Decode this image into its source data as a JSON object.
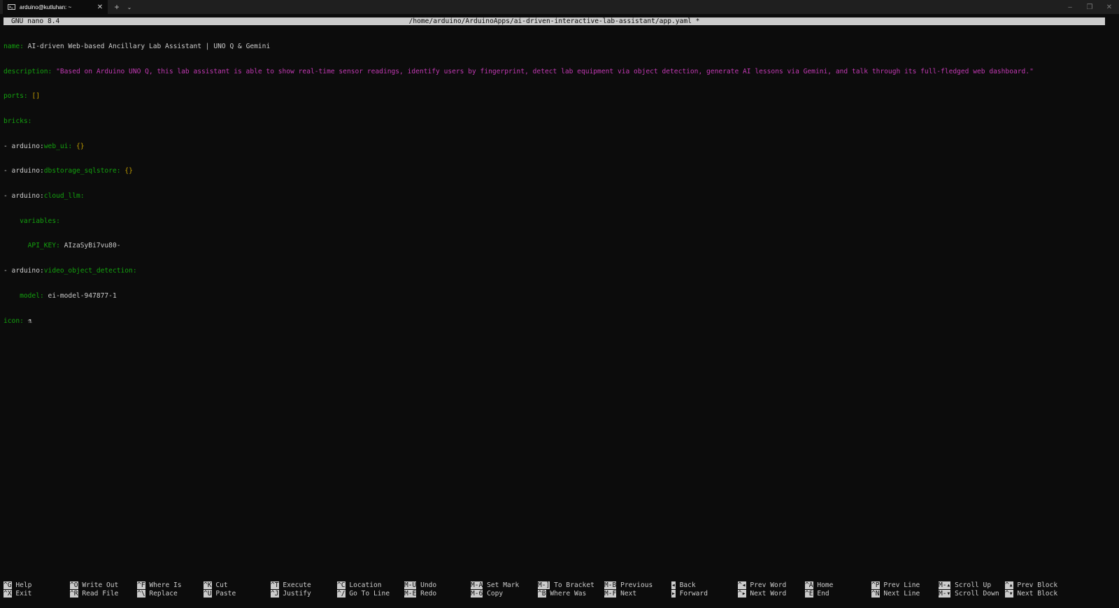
{
  "titlebar": {
    "tab_title": "arduino@kutluhan: ~",
    "tab_icon": "terminal-icon",
    "close_icon": "close-icon",
    "new_tab_symbol": "+",
    "dropdown_symbol": "⌄",
    "minimize_symbol": "–",
    "restore_symbol": "❐",
    "close_window_symbol": "✕"
  },
  "nano": {
    "version": "GNU nano 8.4",
    "path": "/home/arduino/ArduinoApps/ai-driven-interactive-lab-assistant/app.yaml *"
  },
  "editor": {
    "name_key": "name:",
    "name_value": " AI-driven Web-based Ancillary Lab Assistant | UNO Q & Gemini",
    "description_key": "description:",
    "description_value": " \"Based on Arduino UNO Q, this lab assistant is able to show real-time sensor readings, identify users by fingerprint, detect lab equipment via object detection, generate AI lessons via Gemini, and talk through its full-fledged web dashboard.\"",
    "ports_key": "ports:",
    "ports_value": "[]",
    "bricks_key": "bricks:",
    "brick1_prefix": "- arduino:",
    "brick1_name": "web_ui:",
    "brick1_value": "{}",
    "brick2_prefix": "- arduino:",
    "brick2_name": "dbstorage_sqlstore:",
    "brick2_value": "{}",
    "brick3_prefix": "- arduino:",
    "brick3_name": "cloud_llm:",
    "variables_key": "variables:",
    "api_key_key": "API_KEY:",
    "api_key_value": " AIzaSyBi7vu80-",
    "brick4_prefix": "- arduino:",
    "brick4_name": "video_object_detection:",
    "model_key": "model:",
    "model_value": " ei-model-947877-1",
    "icon_key": "icon:",
    "icon_value": " ⚗"
  },
  "shortcuts": {
    "row1": [
      {
        "key": "^G",
        "label": "Help"
      },
      {
        "key": "^O",
        "label": "Write Out"
      },
      {
        "key": "^F",
        "label": "Where Is"
      },
      {
        "key": "^K",
        "label": "Cut"
      },
      {
        "key": "^T",
        "label": "Execute"
      },
      {
        "key": "^C",
        "label": "Location"
      },
      {
        "key": "M-U",
        "label": "Undo"
      },
      {
        "key": "M-A",
        "label": "Set Mark"
      },
      {
        "key": "M-]",
        "label": "To Bracket"
      },
      {
        "key": "M-B",
        "label": "Previous"
      },
      {
        "key": "◂",
        "label": "Back"
      },
      {
        "key": "^◂",
        "label": "Prev Word"
      },
      {
        "key": "^A",
        "label": "Home"
      },
      {
        "key": "^P",
        "label": "Prev Line"
      },
      {
        "key": "M-▴",
        "label": "Scroll Up"
      },
      {
        "key": "^▴",
        "label": "Prev Block"
      }
    ],
    "row2": [
      {
        "key": "^X",
        "label": "Exit"
      },
      {
        "key": "^R",
        "label": "Read File"
      },
      {
        "key": "^\\",
        "label": "Replace"
      },
      {
        "key": "^U",
        "label": "Paste"
      },
      {
        "key": "^J",
        "label": "Justify"
      },
      {
        "key": "^/",
        "label": "Go To Line"
      },
      {
        "key": "M-E",
        "label": "Redo"
      },
      {
        "key": "M-6",
        "label": "Copy"
      },
      {
        "key": "^B",
        "label": "Where Was"
      },
      {
        "key": "M-F",
        "label": "Next"
      },
      {
        "key": "▸",
        "label": "Forward"
      },
      {
        "key": "^▸",
        "label": "Next Word"
      },
      {
        "key": "^E",
        "label": "End"
      },
      {
        "key": "^N",
        "label": "Next Line"
      },
      {
        "key": "M-▾",
        "label": "Scroll Down"
      },
      {
        "key": "^▾",
        "label": "Next Block"
      }
    ]
  }
}
